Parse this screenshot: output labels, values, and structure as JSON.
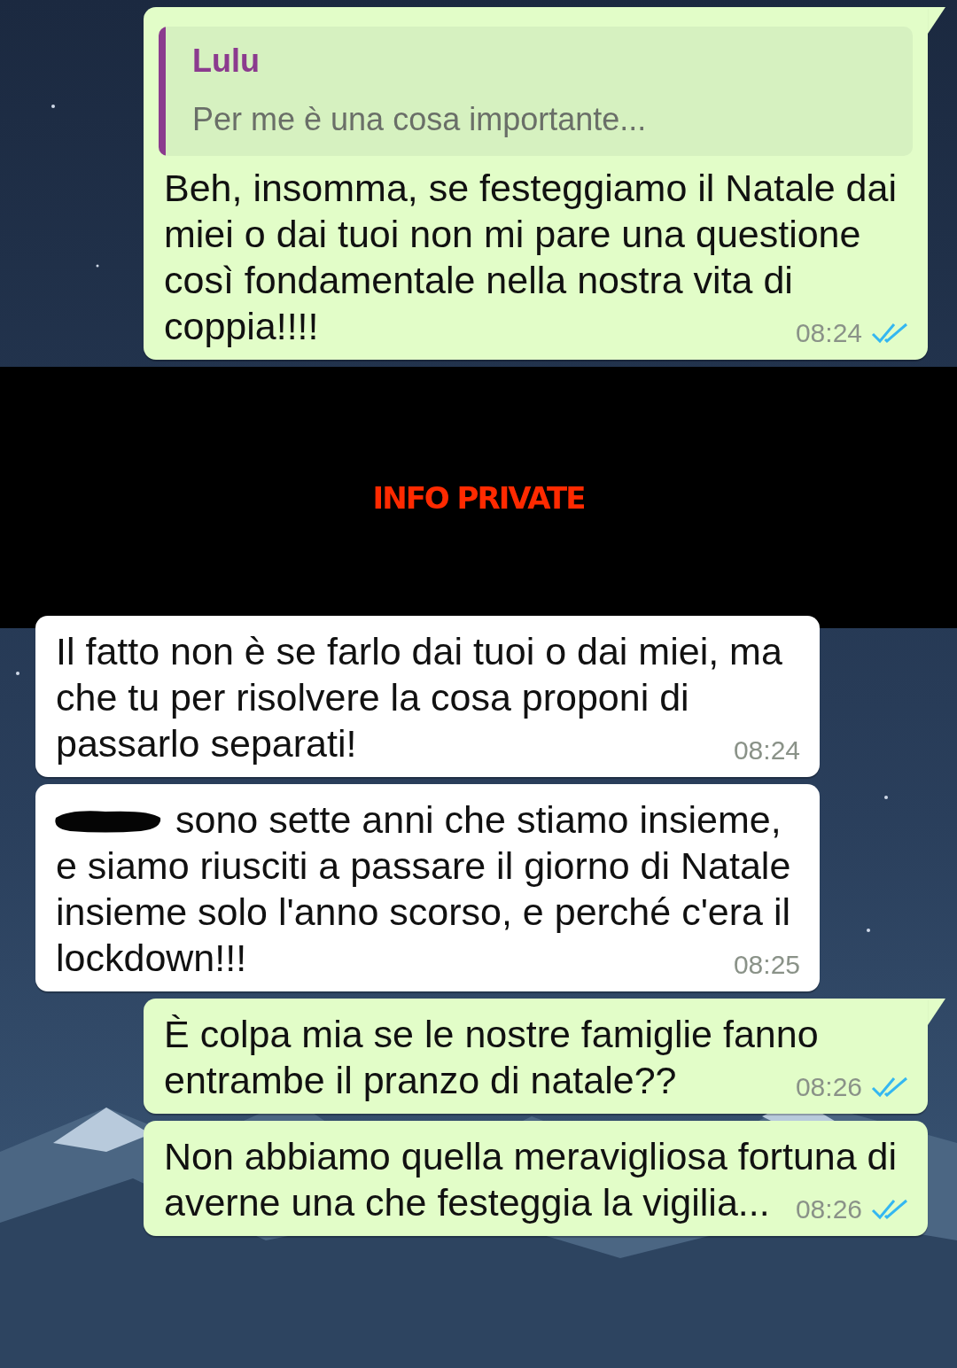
{
  "messages_above": [
    {
      "outgoing": true,
      "tail": true,
      "read": true,
      "quote": {
        "author": "Lulu",
        "text": "Per me è una cosa importante..."
      },
      "text": "Beh, insomma, se festeggiamo il Natale dai miei o dai tuoi non mi pare una questione così fondamentale nella nostra vita di coppia!!!!",
      "time": "08:24"
    }
  ],
  "redaction_bar": {
    "label": "INFO PRIVATE"
  },
  "messages_below": [
    {
      "outgoing": false,
      "tail": false,
      "text": "Il fatto non è se farlo dai tuoi o dai miei, ma che tu per risolvere la cosa proponi di passarlo separati!",
      "time": "08:24"
    },
    {
      "outgoing": false,
      "tail": false,
      "scribbled": true,
      "text": "sono sette anni che stiamo insieme, e siamo riusciti a passare il giorno di Natale insieme solo l'anno scorso, e perché c'era il lockdown!!!",
      "time": "08:25"
    },
    {
      "outgoing": true,
      "tail": true,
      "read": true,
      "text": "È colpa mia se le nostre famiglie fanno entrambe il pranzo di natale??",
      "time": "08:26"
    },
    {
      "outgoing": true,
      "tail": false,
      "read": true,
      "text": "Non abbiamo quella meravigliosa fortuna di averne una che festeggia la vigilia...",
      "time": "08:26"
    }
  ]
}
